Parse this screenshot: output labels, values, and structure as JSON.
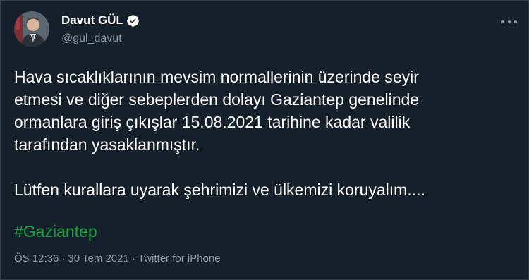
{
  "author": {
    "display_name": "Davut GÜL",
    "handle": "@gul_davut",
    "verified_icon": "verified-badge-icon"
  },
  "menu": {
    "icon": "more-horizontal-icon"
  },
  "tweet": {
    "text": "Hava sıcaklıklarının mevsim normallerinin üzerinde seyir\netmesi ve diğer sebeplerden dolayı Gaziantep genelinde\normanlara giriş çıkışlar 15.08.2021 tarihine kadar valilik\ntarafından yasaklanmıştır.\n\nLütfen kurallara uyarak şehrimizi ve ülkemizi koruyalım....",
    "hashtag": "#Gaziantep"
  },
  "meta": {
    "time": "ÖS 12:36",
    "separator": "·",
    "date": "30 Tem 2021",
    "source": "Twitter for iPhone"
  },
  "colors": {
    "background": "#15202b",
    "text": "#ffffff",
    "secondary": "#8899a6",
    "hashtag": "#1aa344",
    "verified": "#ffffff"
  }
}
